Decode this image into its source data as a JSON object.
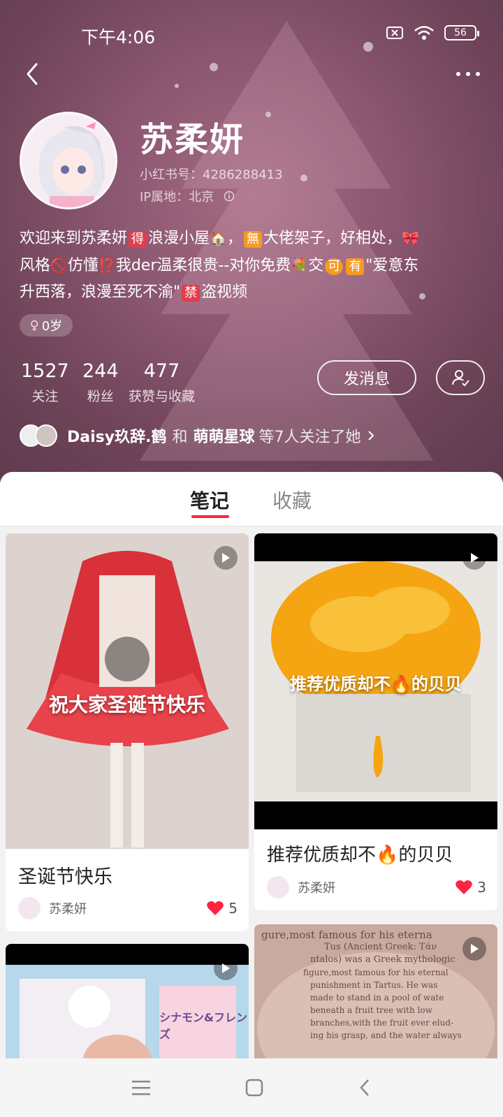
{
  "status": {
    "time": "下午4:06",
    "battery": "56"
  },
  "profile": {
    "name": "苏柔妍",
    "id_label": "小红书号：4286288413",
    "ip_label": "IP属地：北京",
    "bio_line1_a": "欢迎来到苏柔妍",
    "bio_line1_b": "浪漫小屋",
    "bio_line1_c": "，",
    "bio_line1_d": "大佬架子，好相处，",
    "bio_line2_a": "风格",
    "bio_line2_b": "仿懂",
    "bio_line2_c": "我der温柔很贵--对你免费",
    "bio_line2_d": "交",
    "bio_line2_e": "\"爱意东",
    "bio_line3_a": "升西落，浪漫至死不渝\"",
    "bio_line3_b": "盗视频",
    "badge_de": "得",
    "badge_wu": "無",
    "badge_ke": "可",
    "badge_you": "有",
    "badge_jin": "禁",
    "gender_age": "0岁"
  },
  "stats": {
    "following_num": "1527",
    "following_label": "关注",
    "fans_num": "244",
    "fans_label": "粉丝",
    "likes_num": "477",
    "likes_label": "获赞与收藏"
  },
  "actions": {
    "message": "发消息"
  },
  "mutual": {
    "name1": "Daisy玖辞.鹤",
    "and": "和",
    "name2": "萌萌星球",
    "suffix": "等7人关注了她"
  },
  "tabs": {
    "notes": "笔记",
    "collect": "收藏"
  },
  "cards": [
    {
      "overlay": "祝大家圣诞节快乐",
      "title": "圣诞节快乐",
      "author": "苏柔妍",
      "likes": "5"
    },
    {
      "overlay": "推荐优质却不🔥的贝贝",
      "title": "推荐优质却不🔥的贝贝",
      "author": "苏柔妍",
      "likes": "3"
    }
  ],
  "card4_text": [
    "gure,most famous for his eterna",
    "ntalos) was a Greek mythologic",
    "figure,most famous for his eternal",
    "punishment in Tartus. He was",
    "made to stand in a pool of wate",
    "beneath a fruit tree with low",
    "branches,with the fruit ever elud-",
    "ing his grasp, and the water always"
  ],
  "card4_heading": "Tus (Ancient Greek: Tάν",
  "card3_text": "シナモン&フレンズ",
  "colors": {
    "accent": "#ff2442",
    "header_bg": "#7d4e64"
  }
}
